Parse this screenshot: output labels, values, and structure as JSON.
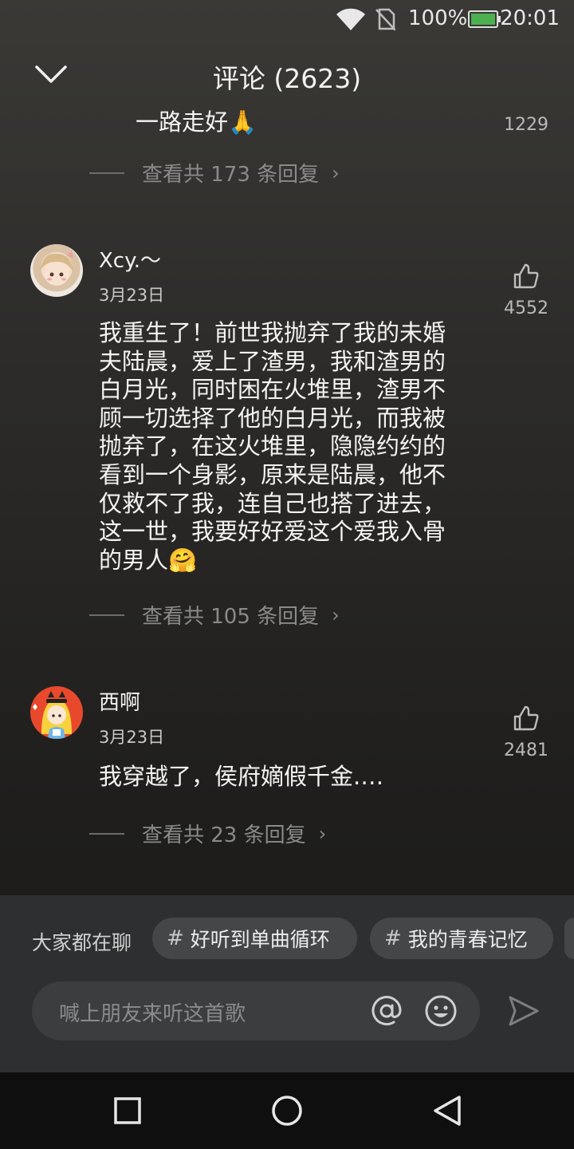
{
  "status_bar": {
    "battery_percent": "100%",
    "time": "20:01",
    "battery_color": "#4caf50"
  },
  "header": {
    "title": "评论 (2623)"
  },
  "comments": [
    {
      "text": "一路走好🙏",
      "likes": "1229",
      "replies": "查看共 173 条回复"
    },
    {
      "user": "Xcy.～",
      "date": "3月23日",
      "likes": "4552",
      "lines": [
        "我重生了！前世我抛弃了我的未婚",
        "夫陆晨，爱上了渣男，我和渣男的",
        "白月光，同时困在火堆里，渣男不",
        "顾一切选择了他的白月光，而我被",
        "抛弃了，在这火堆里，隐隐约约的",
        "看到一个身影，原来是陆晨，他不",
        "仅救不了我，连自己也搭了进去，",
        "这一世，我要好好爱这个爱我入骨",
        "的男人🤗"
      ],
      "replies": "查看共 105 条回复"
    },
    {
      "user": "西啊",
      "date": "3月23日",
      "likes": "2481",
      "text": "我穿越了，侯府嫡假千金.…",
      "replies": "查看共 23 条回复"
    }
  ],
  "topics": {
    "label": "大家都在聊",
    "chips": [
      "好听到单曲循环",
      "我的青春记忆"
    ]
  },
  "composer": {
    "placeholder": "喊上朋友来听这首歌"
  },
  "colors": {
    "panel": "#2e2f30",
    "chip": "#454647",
    "navbar": "#0f0f0f"
  }
}
